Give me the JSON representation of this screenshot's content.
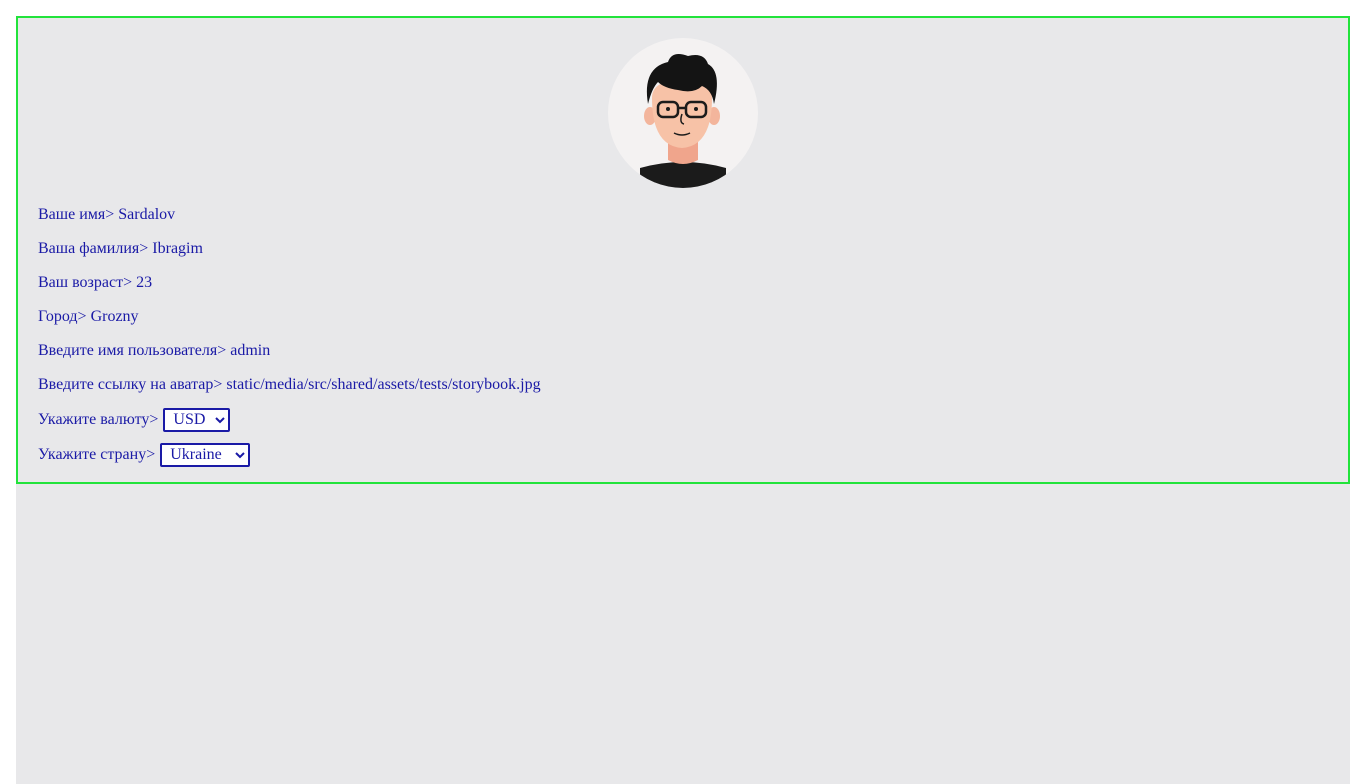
{
  "profile": {
    "first_name_label": "Ваше имя",
    "first_name_value": "Sardalov",
    "last_name_label": "Ваша фамилия",
    "last_name_value": "Ibragim",
    "age_label": "Ваш возраст",
    "age_value": "23",
    "city_label": "Город",
    "city_value": "Grozny",
    "username_label": "Введите имя пользователя",
    "username_value": "admin",
    "avatar_label": "Введите ссылку на аватар",
    "avatar_value": "static/media/src/shared/assets/tests/storybook.jpg",
    "currency_label": "Укажите валюту",
    "currency_value": "USD",
    "country_label": "Укажите страну",
    "country_value": "Ukraine",
    "separator": ">"
  },
  "colors": {
    "text": "#1a1aa6",
    "card_border": "#22e33b",
    "background": "#e8e8ea"
  }
}
